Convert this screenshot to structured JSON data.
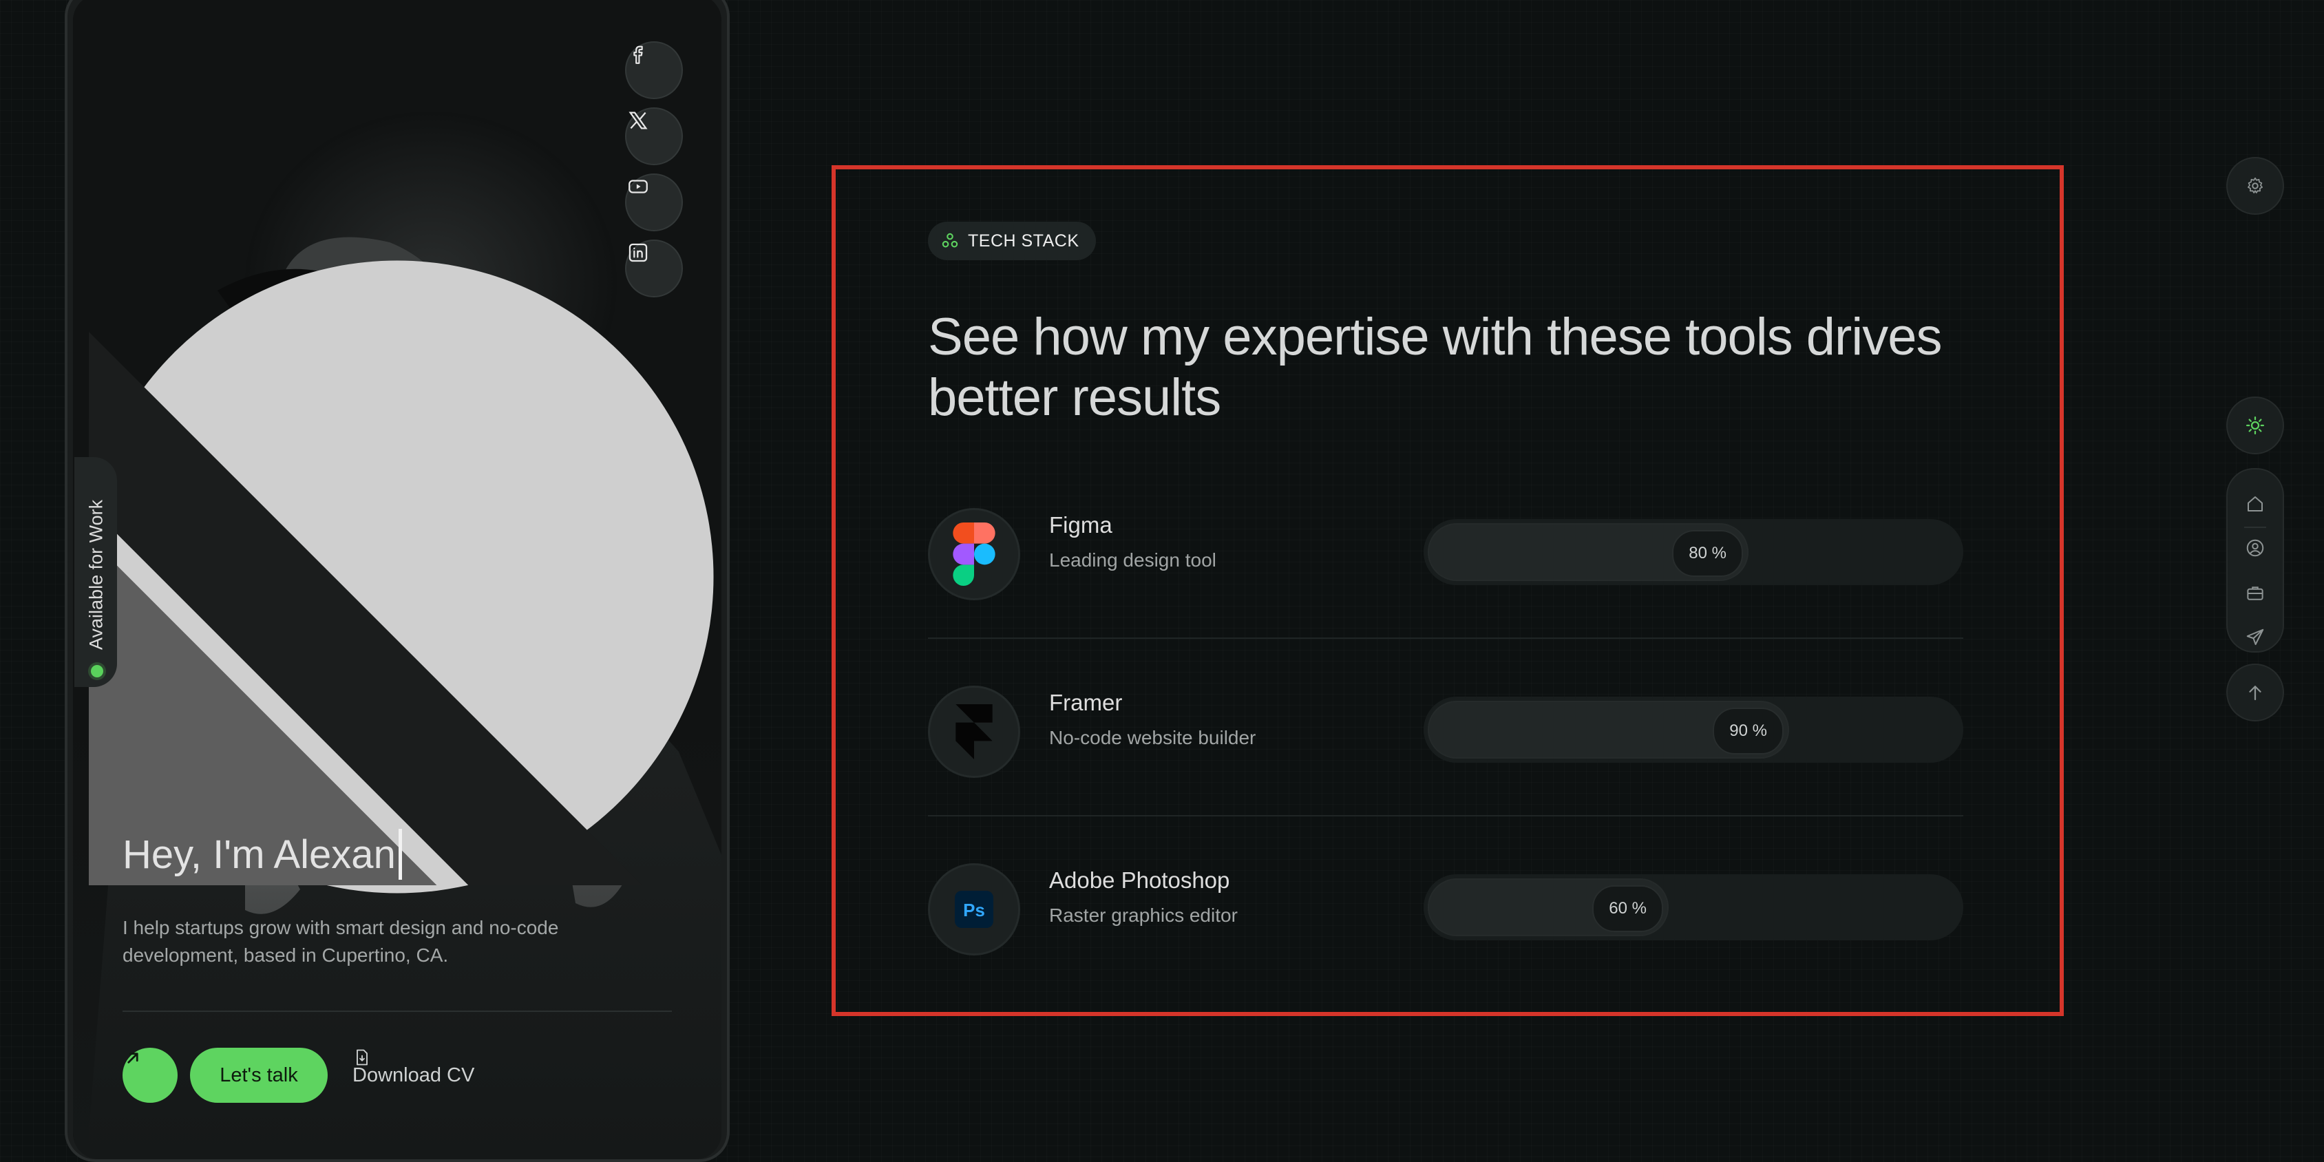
{
  "profile": {
    "availability": "Available for Work",
    "headline": "Hey, I'm Alexan",
    "bio": "I help startups grow with smart design and no-code development, based in Cupertino, CA.",
    "cta_primary": "Let's talk",
    "cta_secondary": "Download CV",
    "socials": [
      "facebook-icon",
      "x-icon",
      "youtube-icon",
      "linkedin-icon"
    ],
    "accent": "#5ed460"
  },
  "tech_stack": {
    "badge": "TECH STACK",
    "heading": "See how my expertise with these tools drives better results",
    "tools": [
      {
        "name": "Figma",
        "description": "Leading design tool",
        "percent_label": "80 %",
        "level": 0.8
      },
      {
        "name": "Framer",
        "description": "No-code website builder",
        "percent_label": "90 %",
        "level": 0.9
      },
      {
        "name": "Adobe Photoshop",
        "description": "Raster graphics editor",
        "percent_label": "60 %",
        "level": 0.6
      }
    ]
  },
  "sidebar": {
    "controls": [
      "settings-icon",
      "theme-toggle-icon",
      "home-icon",
      "about-icon",
      "portfolio-icon",
      "contact-icon",
      "scroll-top-icon"
    ]
  }
}
